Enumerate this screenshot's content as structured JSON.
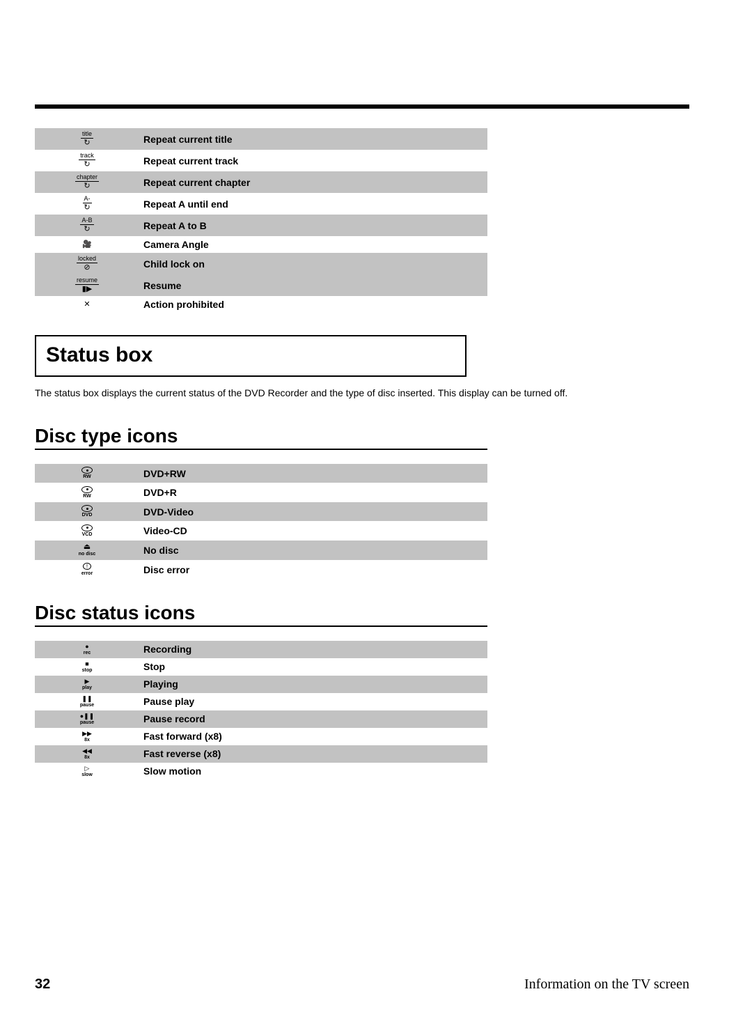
{
  "top_rows": [
    {
      "icon_label": "title",
      "icon_sym": "↻",
      "desc": "Repeat current title",
      "shade": true
    },
    {
      "icon_label": "track",
      "icon_sym": "↻",
      "desc": "Repeat current track",
      "shade": false
    },
    {
      "icon_label": "chapter",
      "icon_sym": "↻",
      "desc": "Repeat current chapter",
      "shade": true
    },
    {
      "icon_label": "A-",
      "icon_sym": "↻",
      "desc": "Repeat A until end",
      "shade": false
    },
    {
      "icon_label": "A-B",
      "icon_sym": "↻",
      "desc": "Repeat A to B",
      "shade": true
    },
    {
      "icon_label": "",
      "icon_sym": "🎥",
      "desc": "Camera Angle",
      "shade": false
    },
    {
      "icon_label": "locked",
      "icon_sym": "⊘",
      "desc": "Child lock on",
      "shade": true
    },
    {
      "icon_label": "resume",
      "icon_sym": "▮▶",
      "desc": "Resume",
      "shade": false,
      "shade_override": true
    },
    {
      "icon_label": "",
      "icon_sym": "✕",
      "desc": "Action prohibited",
      "shade": false
    }
  ],
  "status_box_title": "Status box",
  "status_text": "The status box displays the current status of the DVD Recorder and the type of disc inserted. This display can be turned off.",
  "disc_type_title": "Disc type icons",
  "disc_type_rows": [
    {
      "icon_sub": "RW",
      "desc": "DVD+RW",
      "shade": true,
      "kind": "disc"
    },
    {
      "icon_sub": "RW",
      "desc": "DVD+R",
      "shade": false,
      "kind": "disc"
    },
    {
      "icon_sub": "DVD",
      "desc": "DVD-Video",
      "shade": true,
      "kind": "disc"
    },
    {
      "icon_sub": "VCD",
      "desc": "Video-CD",
      "shade": false,
      "kind": "disc"
    },
    {
      "icon_sub": "no disc",
      "desc": "No disc",
      "shade": true,
      "kind": "tray"
    },
    {
      "icon_sub": "error",
      "desc": "Disc error",
      "shade": false,
      "kind": "err"
    }
  ],
  "disc_status_title": "Disc status icons",
  "disc_status_rows": [
    {
      "icon_sym": "●",
      "icon_sub": "rec",
      "desc": "Recording",
      "shade": true
    },
    {
      "icon_sym": "■",
      "icon_sub": "stop",
      "desc": "Stop",
      "shade": false
    },
    {
      "icon_sym": "▶",
      "icon_sub": "play",
      "desc": "Playing",
      "shade": true
    },
    {
      "icon_sym": "❚❚",
      "icon_sub": "pause",
      "desc": "Pause play",
      "shade": false
    },
    {
      "icon_sym": "●❚❚",
      "icon_sub": "pause",
      "desc": "Pause record",
      "shade": true
    },
    {
      "icon_sym": "▶▶",
      "icon_sub": "8x",
      "desc": "Fast forward (x8)",
      "shade": false
    },
    {
      "icon_sym": "◀◀",
      "icon_sub": "8x",
      "desc": "Fast reverse (x8)",
      "shade": true
    },
    {
      "icon_sym": "▷",
      "icon_sub": "slow",
      "desc": "Slow motion",
      "shade": false
    }
  ],
  "footer": {
    "page_number": "32",
    "title": "Information on the TV screen"
  }
}
